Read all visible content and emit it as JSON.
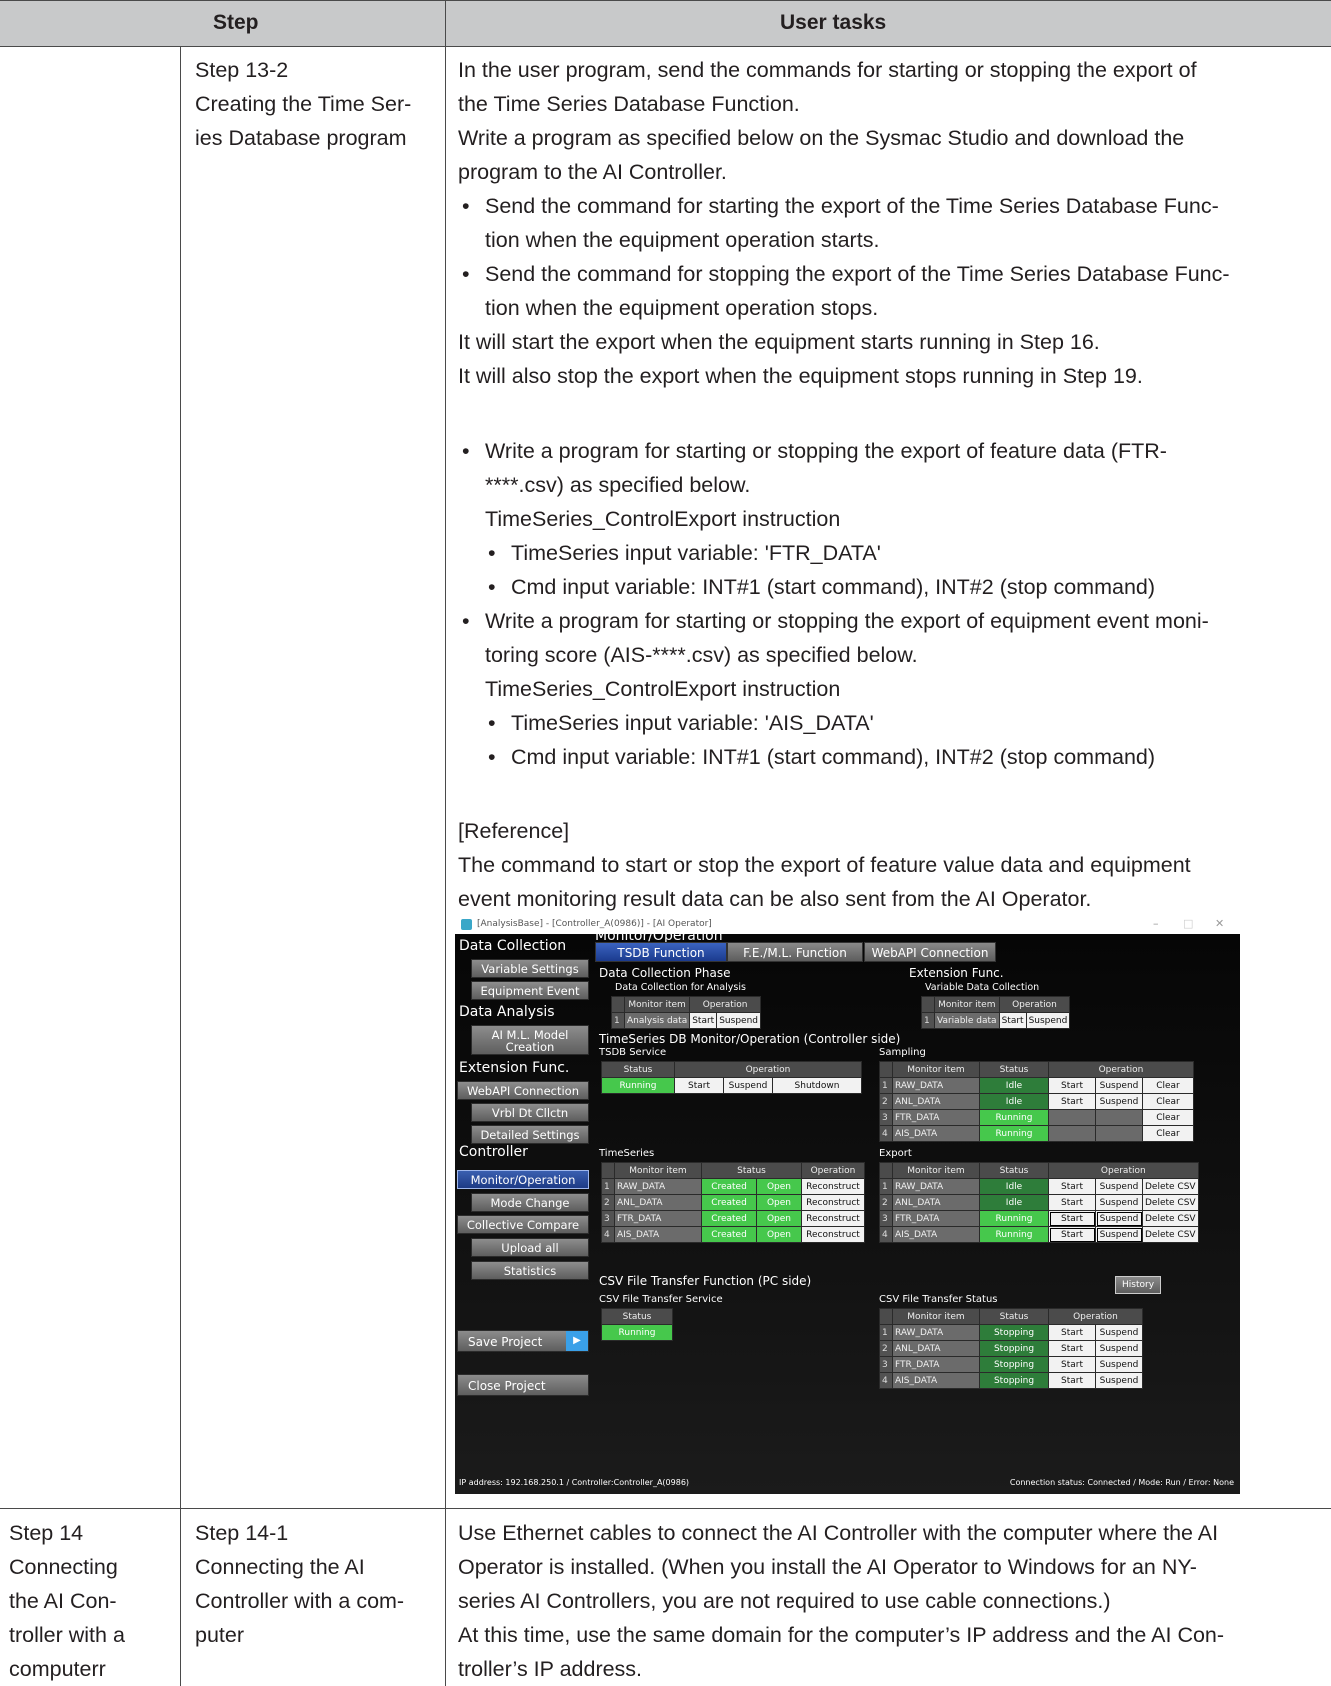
{
  "table": {
    "col_step": "Step",
    "col_tasks": "User tasks"
  },
  "row1": {
    "step_line1": "Step 13-2",
    "step_line2": "Creating the Time Ser-",
    "step_line3": "ies Database program",
    "p1_l1": "In the user program, send the commands for starting or stopping the export of",
    "p1_l2": "the Time Series Database Function.",
    "p2_l1": "Write a program as specified below on the Sysmac Studio and download the",
    "p2_l2": "program to the AI Controller.",
    "b1_l1": "Send the command for starting the export of the Time Series Database Func-",
    "b1_l2": "tion when the equipment operation starts.",
    "b2_l1": "Send the command for stopping the export of the Time Series Database Func-",
    "b2_l2": "tion when the equipment operation stops.",
    "p3": "It will start the export when the equipment starts running in Step 16.",
    "p4": "It will also stop the export when the equipment stops running in Step 19.",
    "b3_l1": "Write a program for starting or stopping the export of feature data (FTR-",
    "b3_l2": "****.csv) as specified below.",
    "b3_l3": "TimeSeries_ControlExport instruction",
    "b3_s1": "TimeSeries input variable: 'FTR_DATA'",
    "b3_s2": "Cmd input variable: INT#1 (start command), INT#2 (stop command)",
    "b4_l1": "Write a program for starting or stopping the export of equipment event moni-",
    "b4_l2": "toring score (AIS-****.csv) as specified below.",
    "b4_l3": "TimeSeries_ControlExport instruction",
    "b4_s1": "TimeSeries input variable: 'AIS_DATA'",
    "b4_s2": "Cmd input variable: INT#1 (start command), INT#2 (stop command)",
    "ref_title": "[Reference]",
    "ref_l1": "The command to start or stop the export of feature value data and equipment",
    "ref_l2": "event monitoring result data can be also sent from the AI Operator."
  },
  "row2": {
    "col1_l1": "Step 14",
    "col1_l2": "Connecting",
    "col1_l3": "the AI Con-",
    "col1_l4": "troller with a",
    "col1_l5": "computerr",
    "col2_l1": "Step 14-1",
    "col2_l2": "Connecting the AI",
    "col2_l3": "Controller with a com-",
    "col2_l4": "puter",
    "t_l1": "Use Ethernet cables to connect the AI Controller with the computer where the AI",
    "t_l2": "Operator is installed. (When you install the AI Operator to Windows for an NY-",
    "t_l3": "series AI Controllers, you are not required to use cable connections.)",
    "t_l4": "At this time, use the same domain for the computer’s IP address and the AI Con-",
    "t_l5": "troller’s IP address."
  },
  "shot": {
    "window_title": "[AnalysisBase] - [Controller_A(0986)] - [AI Operator]",
    "win_min": "–",
    "win_max": "□",
    "win_close": "✕",
    "sidebar": {
      "h1": "Data Collection",
      "b1": "Variable Settings",
      "b2": "Equipment Event",
      "h2": "Data Analysis",
      "b3": "AI M.L. Model Creation",
      "h3": "Extension Func.",
      "b4": "WebAPI Connection",
      "b5": "Vrbl Dt Cllctn",
      "b6": "Detailed Settings",
      "h4": "Controller",
      "b7": "Monitor/Operation",
      "b8": "Mode Change",
      "b9": "Collective Compare",
      "b10": "Upload all",
      "b11": "Statistics",
      "save": "Save Project",
      "close": "Close Project"
    },
    "main_title": "Monitor/Operation",
    "tabs": [
      "TSDB Function",
      "F.E./M.L. Function",
      "WebAPI Connection"
    ],
    "dcp_title": "Data Collection Phase",
    "dcp_sub": "Data Collection for Analysis",
    "ext_title": "Extension Func.",
    "ext_sub": "Variable Data Collection",
    "h_monitor_item": "Monitor item",
    "h_operation": "Operation",
    "h_status": "Status",
    "analysis_data": "Analysis data",
    "variable_data": "Variable data",
    "btn_start": "Start",
    "btn_suspend": "Suspend",
    "btn_shutdown": "Shutdown",
    "btn_clear": "Clear",
    "btn_reconstruct": "Reconstruct",
    "btn_delete_csv": "Delete CSV",
    "tsdb_title": "TimeSeries DB Monitor/Operation (Controller side)",
    "tsdb_service": "TSDB Service",
    "sampling": "Sampling",
    "timeseries": "TimeSeries",
    "export": "Export",
    "running": "Running",
    "idle": "Idle",
    "created": "Created",
    "open": "Open",
    "stopping": "Stopping",
    "items": [
      "RAW_DATA",
      "ANL_DATA",
      "FTR_DATA",
      "AIS_DATA"
    ],
    "csv_title": "CSV File Transfer Function (PC side)",
    "csv_service": "CSV File Transfer Service",
    "csv_status": "CSV File Transfer Status",
    "history": "History",
    "footer_left": "IP address: 192.168.250.1 / Controller:Controller_A(0986)",
    "footer_right": "Connection status: Connected / Mode: Run / Error: None"
  }
}
